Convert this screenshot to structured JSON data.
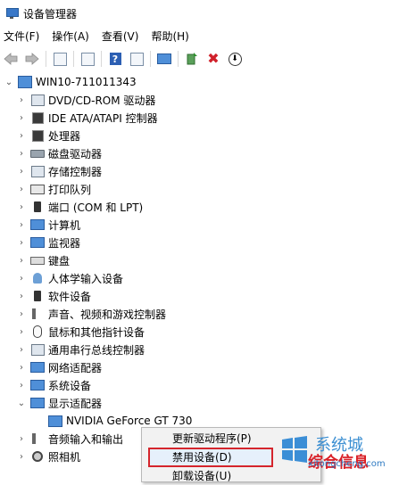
{
  "window": {
    "title": "设备管理器"
  },
  "menu": [
    "文件(F)",
    "操作(A)",
    "查看(V)",
    "帮助(H)"
  ],
  "tree": {
    "root": "WIN10-711011343",
    "items": [
      {
        "label": "DVD/CD-ROM 驱动器",
        "icon": "dvd-drive-icon"
      },
      {
        "label": "IDE ATA/ATAPI 控制器",
        "icon": "ide-controller-icon"
      },
      {
        "label": "处理器",
        "icon": "processor-icon"
      },
      {
        "label": "磁盘驱动器",
        "icon": "disk-drive-icon"
      },
      {
        "label": "存储控制器",
        "icon": "storage-controller-icon"
      },
      {
        "label": "打印队列",
        "icon": "printer-icon"
      },
      {
        "label": "端口 (COM 和 LPT)",
        "icon": "port-icon"
      },
      {
        "label": "计算机",
        "icon": "computer-icon"
      },
      {
        "label": "监视器",
        "icon": "monitor-icon"
      },
      {
        "label": "键盘",
        "icon": "keyboard-icon"
      },
      {
        "label": "人体学输入设备",
        "icon": "hid-icon"
      },
      {
        "label": "软件设备",
        "icon": "software-device-icon"
      },
      {
        "label": "声音、视频和游戏控制器",
        "icon": "sound-icon"
      },
      {
        "label": "鼠标和其他指针设备",
        "icon": "mouse-icon"
      },
      {
        "label": "通用串行总线控制器",
        "icon": "usb-icon"
      },
      {
        "label": "网络适配器",
        "icon": "network-adapter-icon"
      },
      {
        "label": "系统设备",
        "icon": "system-device-icon"
      },
      {
        "label": "显示适配器",
        "icon": "display-adapter-icon"
      },
      {
        "label": "NVIDIA GeForce GT 730",
        "icon": "gpu-icon"
      },
      {
        "label": "音频输入和输出",
        "icon": "audio-io-icon"
      },
      {
        "label": "照相机",
        "icon": "camera-icon"
      }
    ]
  },
  "context_menu": {
    "items": [
      "更新驱动程序(P)",
      "禁用设备(D)",
      "卸载设备(U)"
    ]
  },
  "watermark": {
    "top_text": "系统城",
    "url": "xitongcheng.com",
    "big_text": "综合信息"
  }
}
